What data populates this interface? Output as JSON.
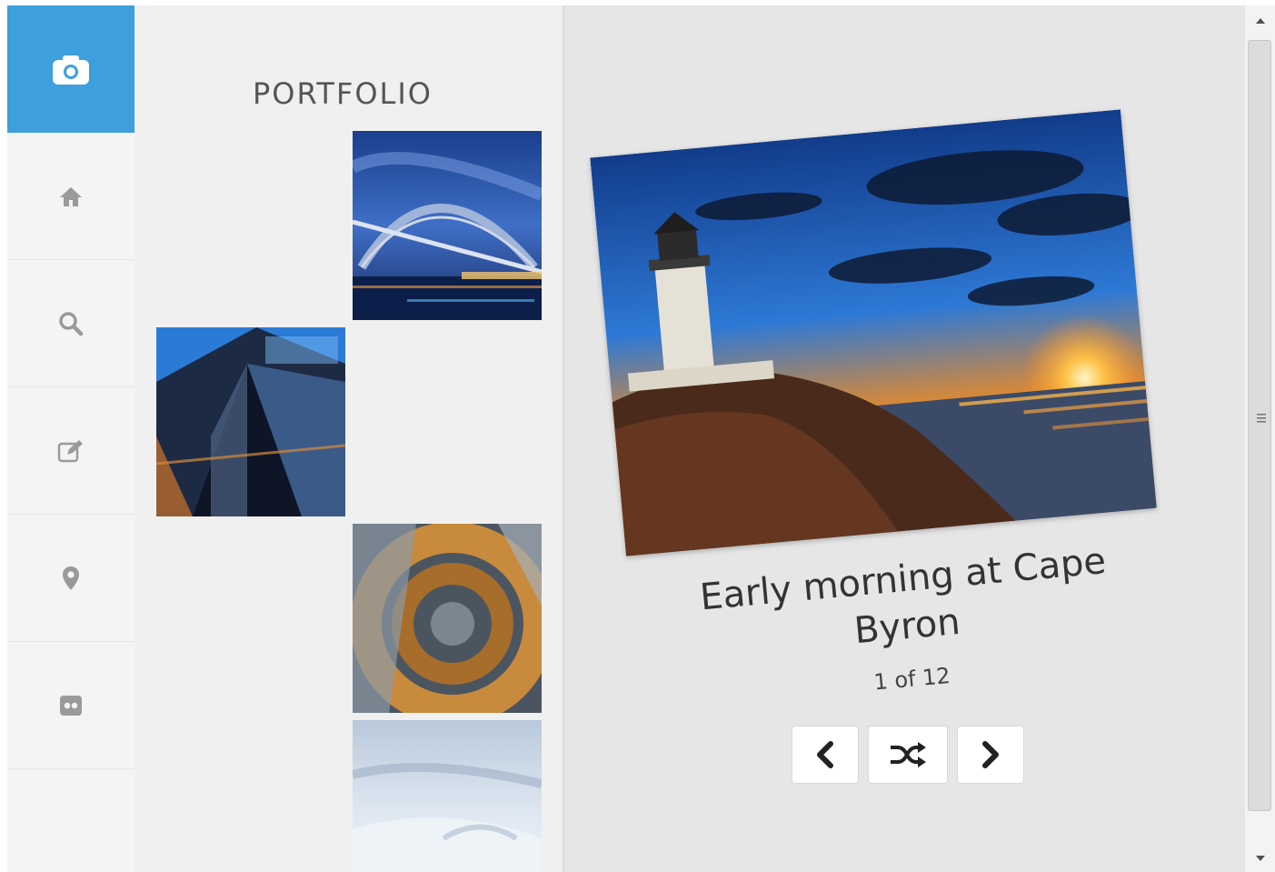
{
  "sidebar": {
    "items": [
      {
        "icon": "camera-icon",
        "active": true
      },
      {
        "icon": "home-icon",
        "active": false
      },
      {
        "icon": "search-icon",
        "active": false
      },
      {
        "icon": "edit-icon",
        "active": false
      },
      {
        "icon": "map-marker-icon",
        "active": false
      },
      {
        "icon": "flickr-icon",
        "active": false
      }
    ]
  },
  "gallery": {
    "title": "PORTFOLIO",
    "thumbnails": [
      {
        "subject": "harbour-bridge-night"
      },
      {
        "subject": "glass-building"
      },
      {
        "subject": "spiral-staircase"
      },
      {
        "subject": "snowy-landscape"
      }
    ]
  },
  "viewer": {
    "caption": "Early morning at Cape Byron",
    "counter": "1 of 12",
    "buttons": {
      "prev_icon": "chevron-left-icon",
      "shuffle_icon": "shuffle-icon",
      "next_icon": "chevron-right-icon"
    }
  },
  "colors": {
    "accent": "#3d9fdc",
    "sidebar_bg": "#f4f4f4",
    "gallery_bg": "#f0f0f0",
    "viewer_bg": "#e6e6e6"
  }
}
